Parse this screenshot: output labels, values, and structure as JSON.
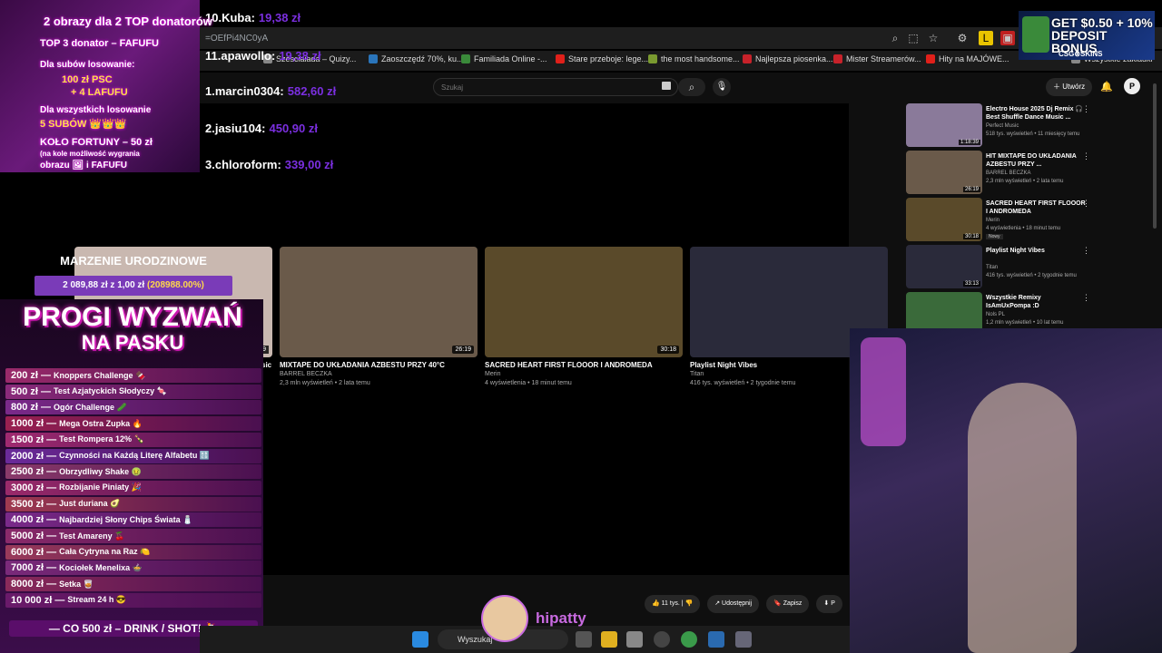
{
  "browser": {
    "url": "=OEfPi4NC0yA",
    "bookmarks": [
      "Szesciaiada – Quizy...",
      "Zaoszczędź 70%, ku...",
      "Familiada Online -...",
      "Stare przeboje: lege...",
      "the most handsome...",
      "Najlepsza piosenka...",
      "Mister Streamerów...",
      "Hity na MAJÓWE...",
      "Wszystkie zakładki"
    ],
    "bookmark_colors": [
      "#888",
      "#2a75bb",
      "#3a8a3a",
      "#e0201a",
      "#7a9a30",
      "#c7222a",
      "#c7222a",
      "#e0201a",
      "#888"
    ]
  },
  "youtube": {
    "search_placeholder": "Szukaj",
    "create_label": "Utwórz",
    "endcards": [
      {
        "title": "MIXTAPE DO UKŁADANIA AZBESTU PRZY 40°C",
        "channel": "BARREL BECZKA",
        "meta": "2,3 mln wyświetleń • 2 lata temu",
        "duration": "26:19",
        "color": "#6a5a4a"
      },
      {
        "title": "SACRED HEART FIRST FLOOOR I ANDROMEDA",
        "channel": "Merin",
        "meta": "4 wyświetlenia • 18 minut temu",
        "duration": "30:18",
        "color": "#5a4a2a"
      },
      {
        "title": "Playlist Night Vibes",
        "channel": "Titan",
        "meta": "416 tys. wyświetleń • 2 tygodnie temu",
        "duration": "",
        "color": "#2a2a3a"
      }
    ],
    "partial_card_text": "sic",
    "partial_card_duration": "39",
    "actions": {
      "likes": "11 tys.",
      "share": "Udostępnij",
      "save": "Zapisz",
      "more": "P"
    },
    "sidebar": [
      {
        "title": "Electro House 2025 Dj Remix 🎧 Best Shuffle Dance Music ...",
        "channel": "Perfect Music",
        "meta": "518 tys. wyświetleń • 11 miesięcy temu",
        "duration": "1:18:39",
        "color": "#8a7a9a",
        "badge": ""
      },
      {
        "title": "HIT MIXTAPE DO UKŁADANIA AZBESTU PRZY ...",
        "channel": "BARREL BECZKA",
        "meta": "2,3 mln wyświetleń • 2 lata temu",
        "duration": "26:19",
        "color": "#6a5a4a",
        "badge": ""
      },
      {
        "title": "SACRED HEART FIRST FLOOOR I ANDROMEDA",
        "channel": "Merin",
        "meta": "4 wyświetlenia • 18 minut temu",
        "duration": "30:18",
        "color": "#5a4a2a",
        "badge": "Nowy"
      },
      {
        "title": "Playlist Night Vibes",
        "channel": "Titan",
        "meta": "416 tys. wyświetleń • 2 tygodnie temu",
        "duration": "33:13",
        "color": "#2a2a3a",
        "badge": ""
      },
      {
        "title": "Wszystkie Remixy IsAmUxPompa :D",
        "channel": "Nols PL",
        "meta": "1,2 mln wyświetleń • 10 lat temu",
        "duration": "",
        "color": "#3a6a3a",
        "badge": ""
      }
    ]
  },
  "leaderboard": [
    {
      "rank": "10.Kuba:",
      "amount": "19,38 zł"
    },
    {
      "rank": "11.apawollo:",
      "amount": "19,38 zł"
    },
    {
      "rank": "1.marcin0304:",
      "amount": "582,60 zł"
    },
    {
      "rank": "2.jasiu104:",
      "amount": "450,90 zł"
    },
    {
      "rank": "3.chloroform:",
      "amount": "339,00 zł"
    }
  ],
  "donator_box": [
    "2 obrazy dla 2 TOP donatorów",
    "TOP 3 donator – FAFUFU",
    "Dla subów losowanie:",
    "100 zł PSC",
    "+ 4 LAFUFU",
    "Dla wszystkich losowanie",
    "5 SUBÓW 👑👑👑",
    "KOŁO FORTUNY – 50 zł",
    "(na kole możliwość wygrania",
    "obrazu 🖼 i FAFUFU"
  ],
  "birthday": {
    "title": "MARZENIE URODZINOWE",
    "amount": "2 089,88 zł z 1,00 zł",
    "percent": "(208988.00%)",
    "progress_percent": 100
  },
  "progi": {
    "title_line1": "PROGI WYZWAŃ",
    "title_line2": "NA PASKU",
    "rows": [
      {
        "amount": "200 zł —",
        "text": "Knoppers Challenge 🍫"
      },
      {
        "amount": "500 zł —",
        "text": "Test Azjatyckich Słodyczy 🍬"
      },
      {
        "amount": "800 zł —",
        "text": "Ogór Challenge 🥒"
      },
      {
        "amount": "1000 zł —",
        "text": "Mega Ostra Zupka 🔥"
      },
      {
        "amount": "1500 zł —",
        "text": "Test Rompera 12% 🍾"
      },
      {
        "amount": "2000 zł —",
        "text": "Czynności na Każdą Literę Alfabetu 🔠"
      },
      {
        "amount": "2500 zł —",
        "text": "Obrzydliwy Shake 🤢"
      },
      {
        "amount": "3000 zł —",
        "text": "Rozbijanie Piniaty 🎉"
      },
      {
        "amount": "3500 zł —",
        "text": "Just duriana 🥑"
      },
      {
        "amount": "4000 zł —",
        "text": "Najbardziej Słony Chips Świata 🧂"
      },
      {
        "amount": "5000 zł —",
        "text": "Test Amareny 🍒"
      },
      {
        "amount": "6000 zł —",
        "text": "Cała Cytryna na Raz 🍋"
      },
      {
        "amount": "7000 zł —",
        "text": "Kociołek Menelixa 🍲"
      },
      {
        "amount": "8000 zł —",
        "text": "Setka 🥃"
      },
      {
        "amount": "10 000 zł —",
        "text": "Stream 24 h 😎"
      }
    ],
    "footer": "— CO 500 zł – DRINK / SHOT! 🍹"
  },
  "ad": {
    "text": "GET $0.50 + 10% DEPOSIT BONUS",
    "brand": "CSG⊗SKINS"
  },
  "streamer_name": "hipatty",
  "taskbar": {
    "search": "Wyszukaj"
  }
}
